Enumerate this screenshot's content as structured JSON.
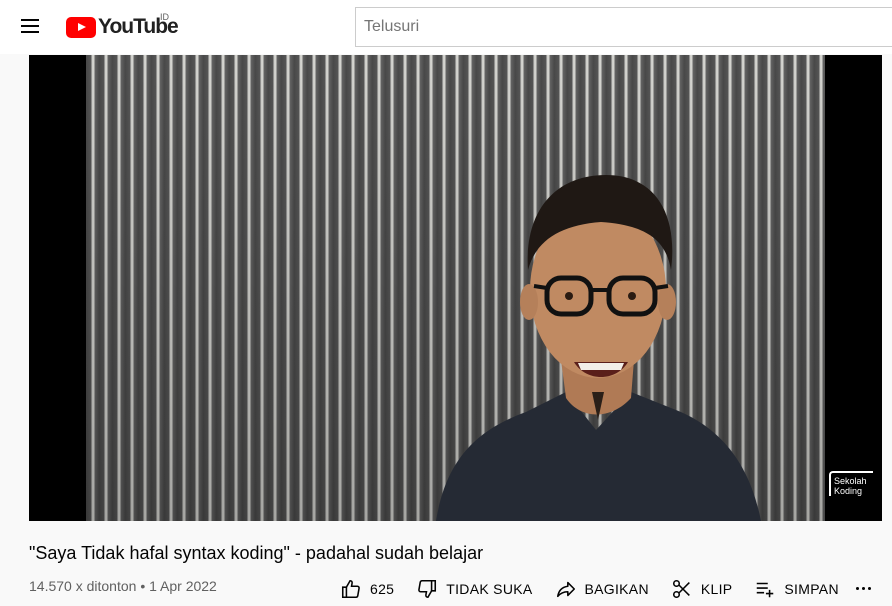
{
  "masthead": {
    "logo_text": "YouTube",
    "region": "ID",
    "search_placeholder": "Telusuri"
  },
  "player": {
    "watermark_line1": "Sekolah",
    "watermark_line2": "Koding"
  },
  "video": {
    "title": "\"Saya Tidak hafal syntax koding\" - padahal sudah belajar",
    "views": "14.570 x ditonton",
    "separator": "•",
    "date": "1 Apr 2022"
  },
  "actions": {
    "like_count": "625",
    "dislike_label": "TIDAK SUKA",
    "share_label": "BAGIKAN",
    "clip_label": "KLIP",
    "save_label": "SIMPAN"
  },
  "colors": {
    "brand": "#ff0000",
    "background": "#f9f9f9",
    "text_secondary": "#606060"
  }
}
